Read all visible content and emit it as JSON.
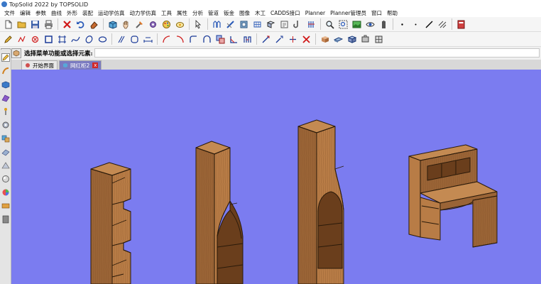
{
  "window": {
    "title": "TopSolid 2022 by TOPSOLID"
  },
  "menu": {
    "items": [
      "文件",
      "编辑",
      "参数",
      "曲线",
      "外形",
      "装配",
      "运动学仿真",
      "动力学仿真",
      "工具",
      "属性",
      "分析",
      "管道",
      "钣金",
      "图像",
      "木工",
      "CADDS接口",
      "Planner",
      "Planner管理员",
      "窗口",
      "帮助"
    ]
  },
  "toolbar_icons": {
    "row1": [
      "new-document",
      "open-folder",
      "save",
      "print",
      "delete",
      "undo",
      "eraser",
      "cube-blue",
      "hand-move",
      "tools",
      "settings",
      "palette",
      "lamp",
      "cursor-select",
      "fence",
      "pipe",
      "shape",
      "mesh",
      "part",
      "sheet",
      "hook",
      "clip",
      "zoom",
      "zoom-area",
      "image",
      "eye",
      "battery",
      "point",
      "line",
      "hatch",
      "book"
    ],
    "row2": [
      "pencil",
      "polyline",
      "circle-cross",
      "rectangle",
      "frame",
      "spline",
      "ellipse",
      "oval",
      "slash",
      "arc-fillet",
      "arc",
      "rect-fillet",
      "arch",
      "boolean",
      "corner",
      "dimension",
      "fence-link",
      "trim",
      "extend",
      "delete-x",
      "box3d",
      "plate",
      "cube-grid",
      "clamp",
      "block"
    ]
  },
  "command": {
    "prompt": "选择菜单功能或选择元素:",
    "input_value": ""
  },
  "tabs": [
    {
      "label": "开始界面",
      "active": false
    },
    {
      "label": "网红柜2",
      "active": true,
      "close": "x"
    }
  ],
  "colors": {
    "viewport_bg": "#7b7cf0",
    "wood_front": "#9a6436",
    "wood_side": "#b87c46",
    "wood_top": "#c48a52",
    "active_tab": "#7a7ac0"
  }
}
